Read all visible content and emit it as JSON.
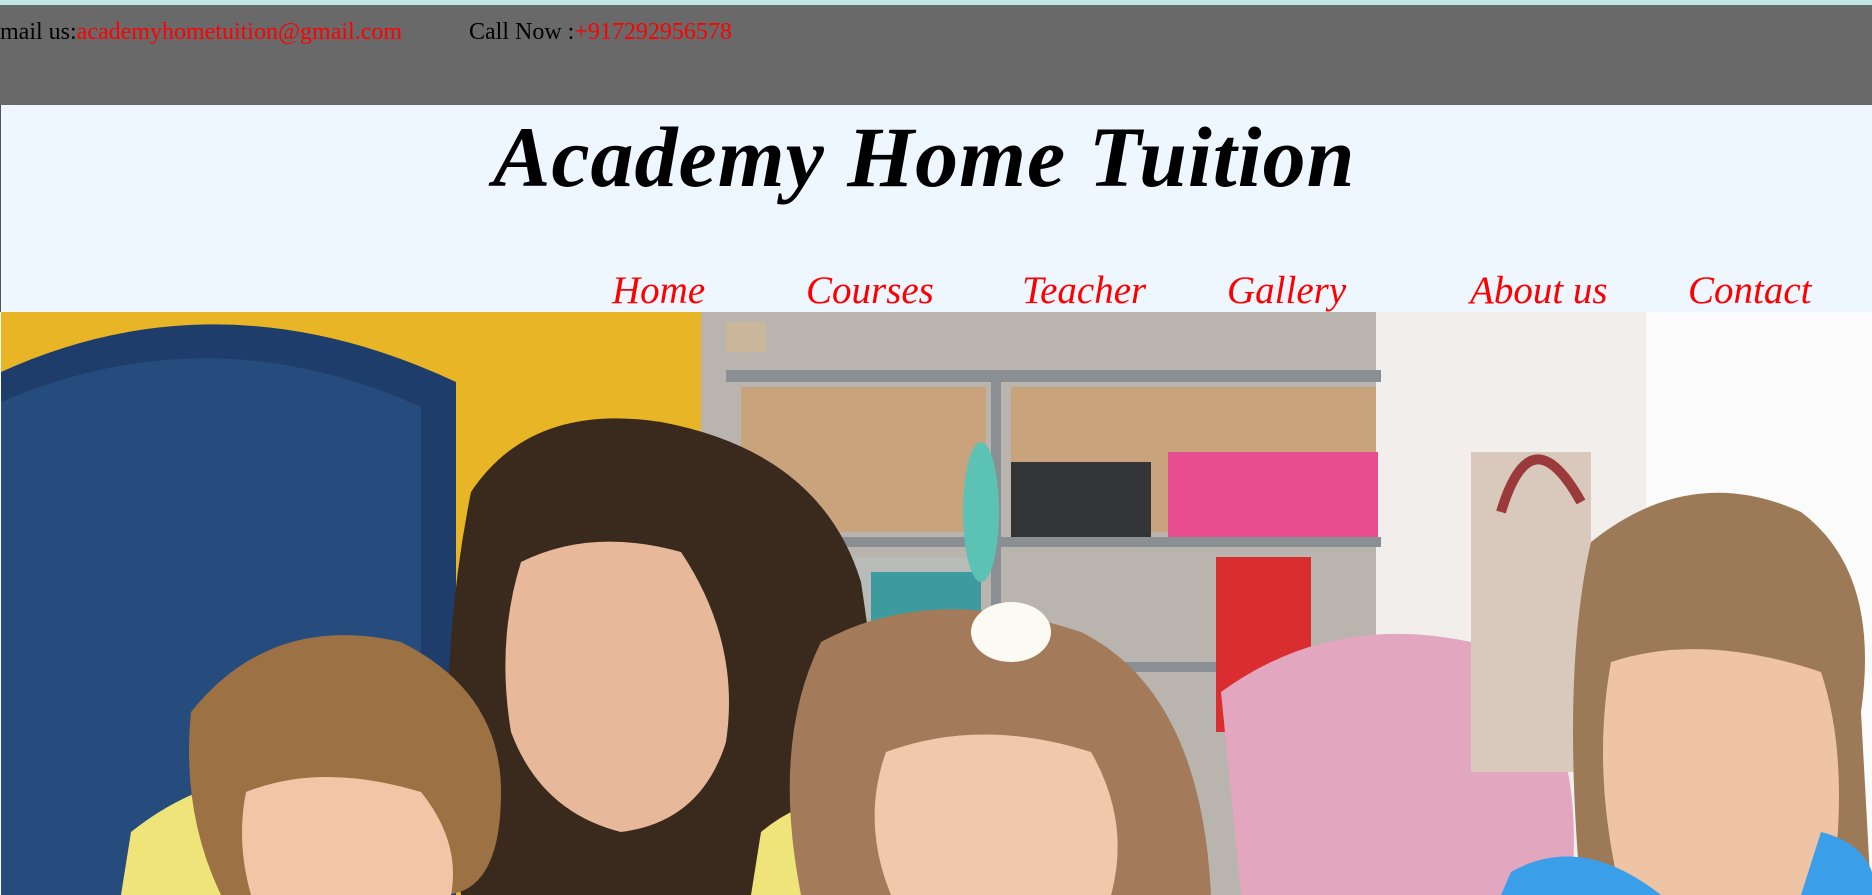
{
  "contact_bar": {
    "mail_label": "mail us:",
    "mail_value": "academyhometuition@gmail.com",
    "call_label": "Call Now :",
    "call_value": "+917292956578"
  },
  "header": {
    "site_title": "Academy Home Tuition"
  },
  "nav": {
    "items": [
      {
        "label": "Home"
      },
      {
        "label": "Courses"
      },
      {
        "label": "Teacher"
      },
      {
        "label": "Gallery"
      },
      {
        "label": "About us"
      },
      {
        "label": "Contact"
      }
    ]
  },
  "colors": {
    "accent": "#ff0000",
    "contact_bar_bg": "#696969",
    "header_bg": "#eef7ff",
    "top_strip": "#c2e6e4"
  },
  "hero": {
    "image_subject": "teacher-with-children-photo"
  }
}
